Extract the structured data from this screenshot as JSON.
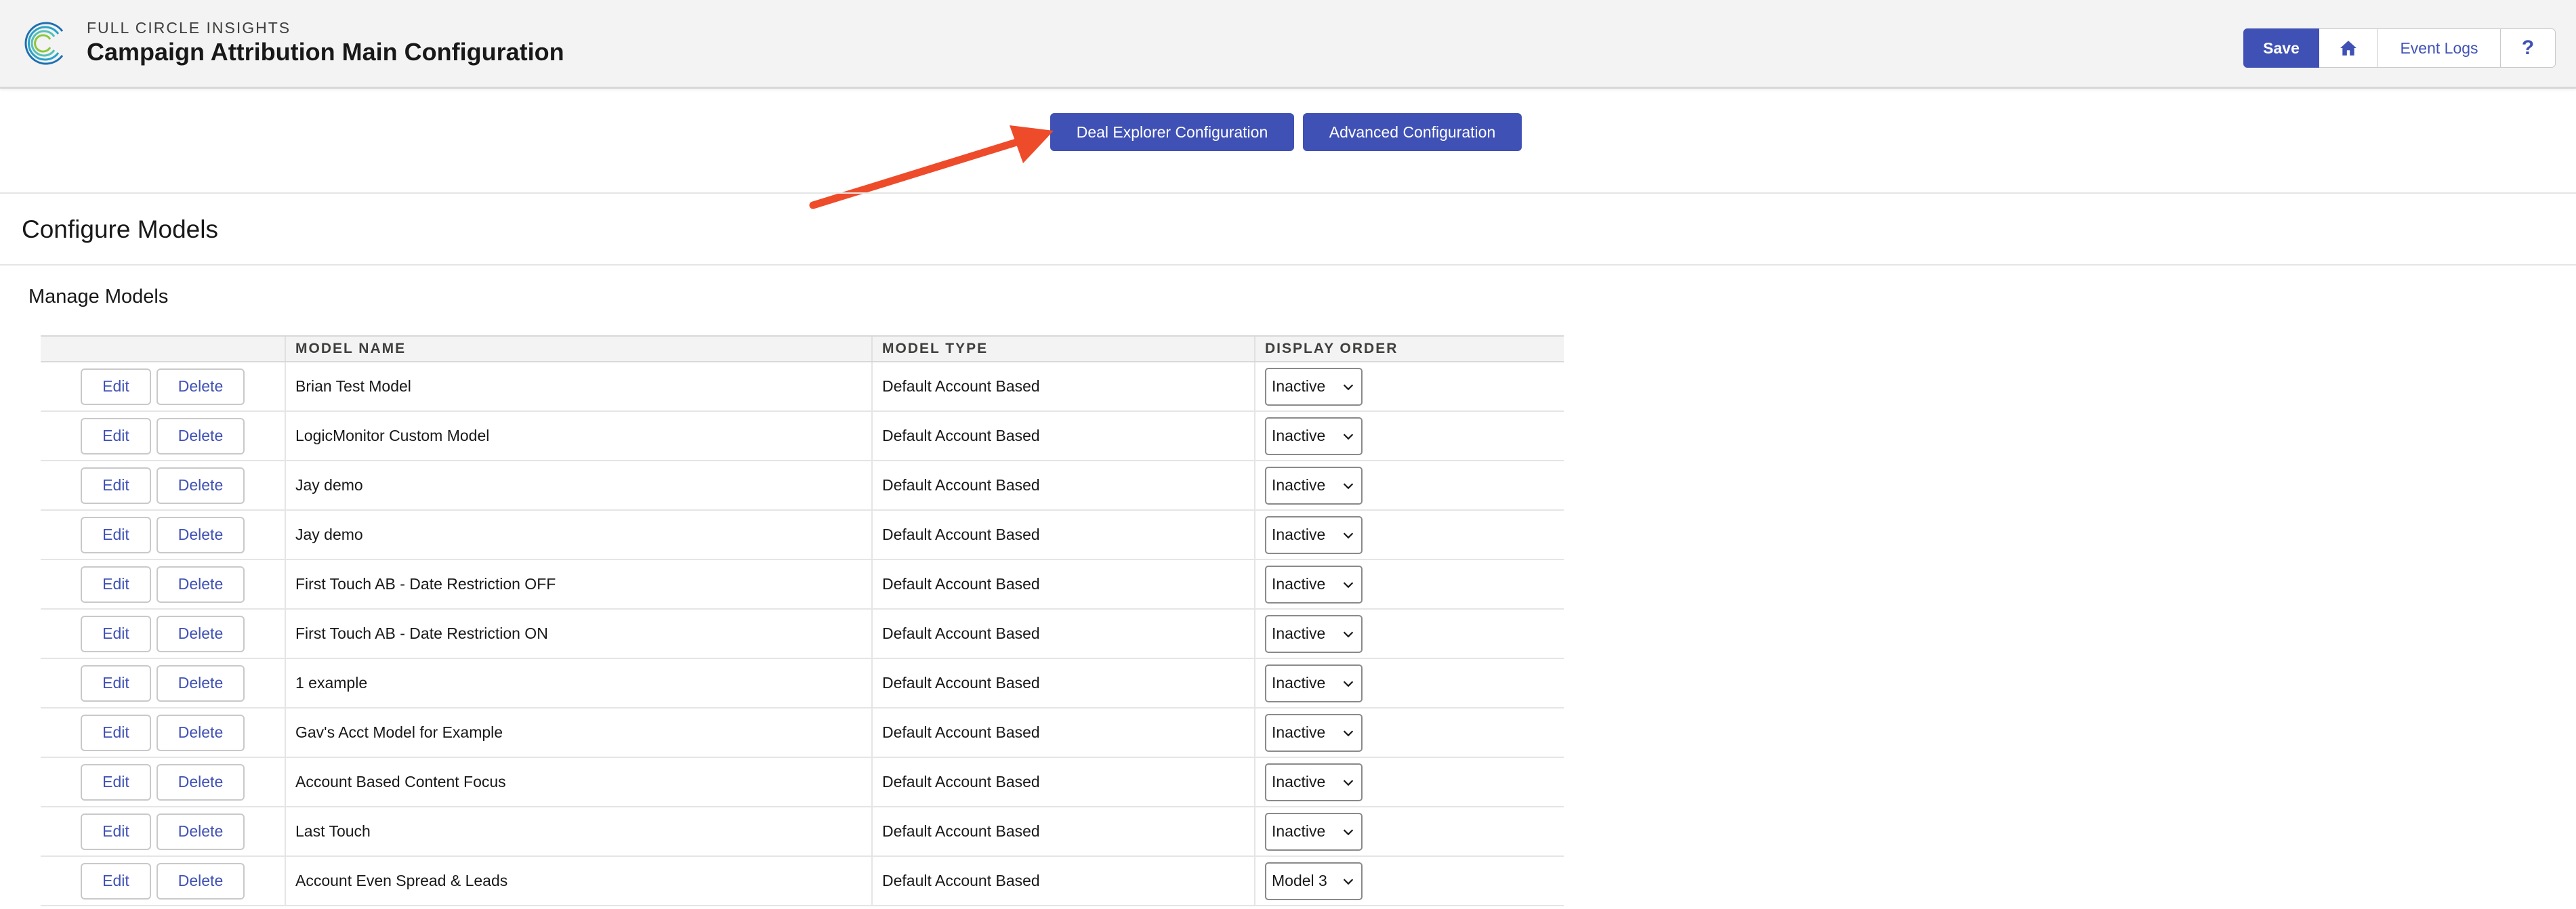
{
  "header": {
    "brand": "FULL CIRCLE INSIGHTS",
    "title": "Campaign Attribution Main Configuration",
    "save_label": "Save",
    "event_logs_label": "Event Logs",
    "help_label": "?",
    "home_icon": "home-icon",
    "logo_icon": "full-circle-logo"
  },
  "actions": {
    "deal_explorer_label": "Deal Explorer Configuration",
    "advanced_label": "Advanced Configuration"
  },
  "section_title": "Configure Models",
  "sub_title": "Manage Models",
  "table": {
    "headers": [
      "",
      "MODEL NAME",
      "MODEL TYPE",
      "DISPLAY ORDER"
    ],
    "edit_label": "Edit",
    "delete_label": "Delete",
    "rows": [
      {
        "name": "Brian Test Model",
        "type": "Default Account Based",
        "order": "Inactive"
      },
      {
        "name": "LogicMonitor Custom Model",
        "type": "Default Account Based",
        "order": "Inactive"
      },
      {
        "name": "Jay demo",
        "type": "Default Account Based",
        "order": "Inactive"
      },
      {
        "name": "Jay demo",
        "type": "Default Account Based",
        "order": "Inactive"
      },
      {
        "name": "First Touch AB - Date Restriction OFF",
        "type": "Default Account Based",
        "order": "Inactive"
      },
      {
        "name": "First Touch AB - Date Restriction ON",
        "type": "Default Account Based",
        "order": "Inactive"
      },
      {
        "name": "1 example",
        "type": "Default Account Based",
        "order": "Inactive"
      },
      {
        "name": "Gav's Acct Model for Example",
        "type": "Default Account Based",
        "order": "Inactive"
      },
      {
        "name": "Account Based Content Focus",
        "type": "Default Account Based",
        "order": "Inactive"
      },
      {
        "name": "Last Touch",
        "type": "Default Account Based",
        "order": "Inactive"
      },
      {
        "name": "Account Even Spread & Leads",
        "type": "Default Account Based",
        "order": "Model 3"
      }
    ]
  },
  "colors": {
    "brand_button": "#3f51b5",
    "arrow": "#ee4b2b"
  }
}
